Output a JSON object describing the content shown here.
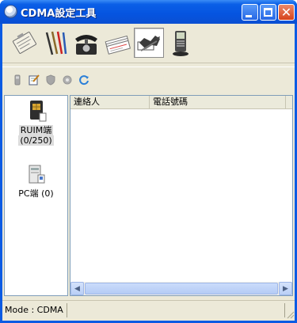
{
  "window": {
    "title": "CDMA設定工具"
  },
  "titlebar_buttons": [
    "minimize",
    "maximize",
    "close"
  ],
  "big_toolbar": {
    "items": [
      {
        "icon": "clipboard-icon"
      },
      {
        "icon": "pens-icon"
      },
      {
        "icon": "telephone-icon"
      },
      {
        "icon": "message-cards-icon"
      },
      {
        "icon": "sync-transfer-icon",
        "selected": true
      },
      {
        "icon": "phone-stack-icon"
      }
    ]
  },
  "small_toolbar": {
    "items": [
      {
        "icon": "phone-small-icon",
        "enabled": false
      },
      {
        "icon": "edit-icon",
        "enabled": true
      },
      {
        "icon": "shield-icon",
        "enabled": false
      },
      {
        "icon": "settings-icon",
        "enabled": false
      },
      {
        "icon": "refresh-icon",
        "enabled": true
      }
    ]
  },
  "devices": [
    {
      "label_line1": "RUIM端",
      "label_line2": "(0/250)",
      "icon": "sim-card-icon",
      "selected": true
    },
    {
      "label_line1": "PC端 (0)",
      "icon": "pc-icon",
      "selected": false
    }
  ],
  "list": {
    "columns": [
      "連絡人",
      "電話號碼"
    ]
  },
  "status": {
    "mode": "Mode : CDMA"
  },
  "colors": {
    "titlebar": "#0554e0",
    "chrome": "#ece9d8",
    "border": "#7f9db9"
  }
}
